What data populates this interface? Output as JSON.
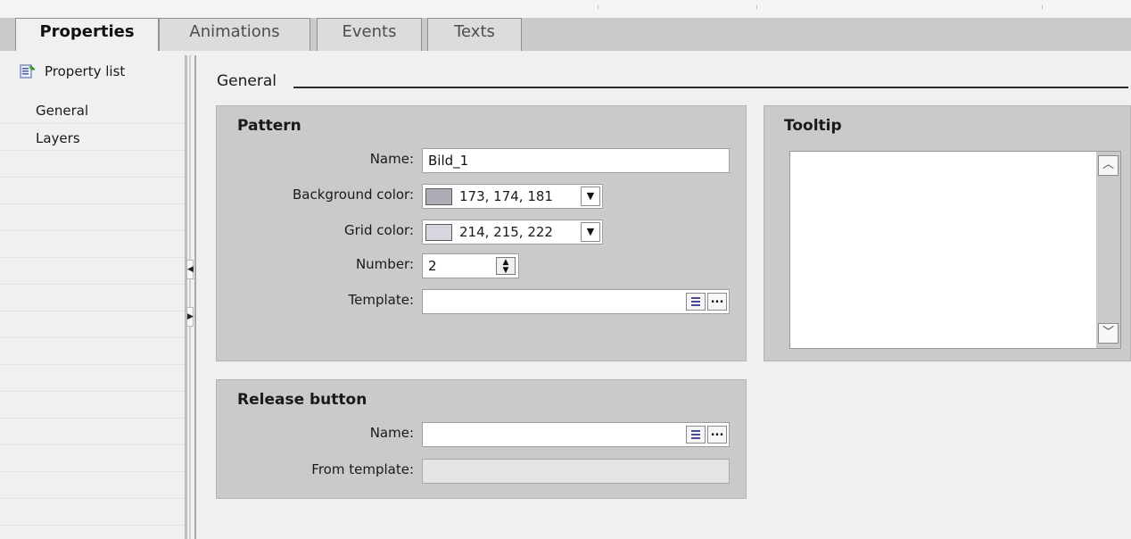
{
  "tabs": [
    {
      "label": "Properties",
      "active": true
    },
    {
      "label": "Animations",
      "active": false
    },
    {
      "label": "Events",
      "active": false
    },
    {
      "label": "Texts",
      "active": false
    }
  ],
  "sidebar": {
    "header": "Property list",
    "items": [
      "General",
      "Layers"
    ]
  },
  "main": {
    "section_title": "General",
    "pattern": {
      "title": "Pattern",
      "name_label": "Name:",
      "name_value": "Bild_1",
      "bg_label": "Background color:",
      "bg_value": "173, 174, 181",
      "bg_swatch": "#adaeb5",
      "grid_label": "Grid color:",
      "grid_value": "214, 215, 222",
      "grid_swatch": "#d6d7de",
      "number_label": "Number:",
      "number_value": "2",
      "template_label": "Template:",
      "template_value": ""
    },
    "tooltip": {
      "title": "Tooltip",
      "text": ""
    },
    "release": {
      "title": "Release button",
      "name_label": "Name:",
      "name_value": "",
      "from_label": "From template:",
      "from_value": ""
    }
  },
  "icons": {
    "property_list": "property-list-icon",
    "dropdown": "chevron-down-icon",
    "spinner": "up-down-spinner-icon",
    "list_button": "list-icon",
    "browse": "ellipsis-icon",
    "scroll_up": "chevron-up-icon",
    "scroll_down": "chevron-down-icon",
    "collapse_left": "triangle-left-icon",
    "expand_right": "triangle-right-icon"
  }
}
